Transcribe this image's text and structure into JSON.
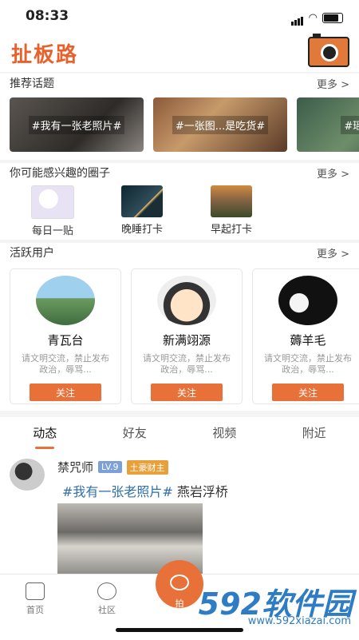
{
  "status": {
    "time": "08:33"
  },
  "app": {
    "title": "扯板路"
  },
  "recommended_topics": {
    "title": "推荐话题",
    "more": "更多 >",
    "items": [
      "#我有一张老照片#",
      "#一张图...是吃货#",
      "#瑶山..."
    ]
  },
  "circles": {
    "title": "你可能感兴趣的圈子",
    "more": "更多 >",
    "items": [
      "每日一贴",
      "晚睡打卡",
      "早起打卡"
    ]
  },
  "active_users": {
    "title": "活跃用户",
    "more": "更多 >",
    "items": [
      {
        "name": "青瓦台",
        "desc": "请文明交流，禁止发布政治，辱骂...",
        "follow": "关注"
      },
      {
        "name": "新满翊源",
        "desc": "请文明交流，禁止发布政治，辱骂...",
        "follow": "关注"
      },
      {
        "name": "薅羊毛",
        "desc": "请文明交流，禁止发布政治，辱骂...",
        "follow": "关注"
      }
    ]
  },
  "tabs": [
    "动态",
    "好友",
    "视频",
    "附近"
  ],
  "post": {
    "user": "禁咒师",
    "level": "LV.9",
    "rank": "土豪财主",
    "tag": "#我有一张老照片#",
    "title": "燕岩浮桥"
  },
  "bottom_nav": {
    "home": "首页",
    "community": "社区",
    "shoot": "拍"
  },
  "watermark": {
    "brand": "592软件园",
    "url": "www.592xiazai.com"
  }
}
